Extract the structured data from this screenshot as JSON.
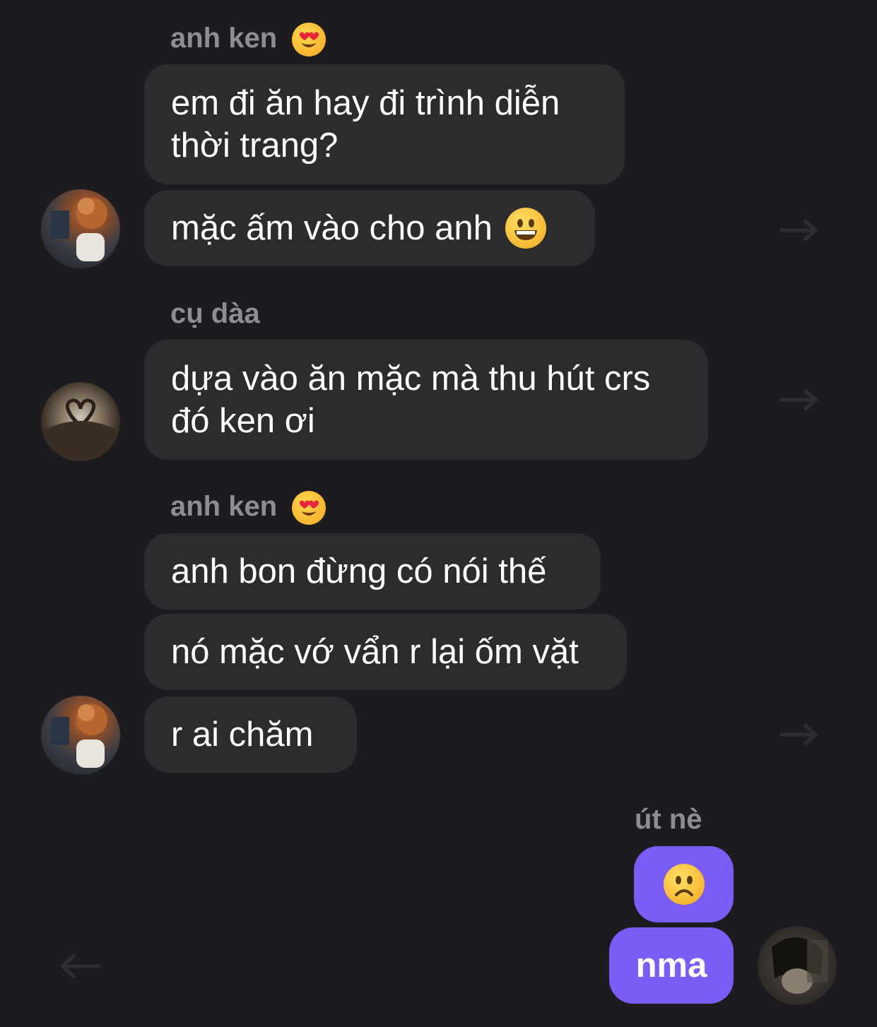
{
  "messages": {
    "group1": {
      "sender": "anh ken",
      "sender_emoji": "heart-eyes-emoji",
      "bubble1": "em đi ăn hay đi trình diễn thời trang?",
      "bubble2": "mặc ấm vào cho anh",
      "bubble2_emoji": "grinning-emoji"
    },
    "group2": {
      "sender": "cụ dàa",
      "bubble1": "dựa vào ăn mặc mà thu hút crs đó ken ơi"
    },
    "group3": {
      "sender": "anh ken",
      "sender_emoji": "heart-eyes-emoji",
      "bubble1": "anh bon đừng có nói thế",
      "bubble2": "nó mặc vớ vẩn r lại ốm vặt",
      "bubble3": "r ai chăm"
    },
    "group4": {
      "sender": "út nè",
      "bubble1_emoji": "frowning-emoji",
      "bubble2": "nma"
    }
  },
  "colors": {
    "background": "#1c1b1f",
    "incoming_bubble": "#2c2c2f",
    "outgoing_bubble": "#7b5cf6",
    "sender_name": "#8e8d93",
    "text": "#ffffff"
  }
}
